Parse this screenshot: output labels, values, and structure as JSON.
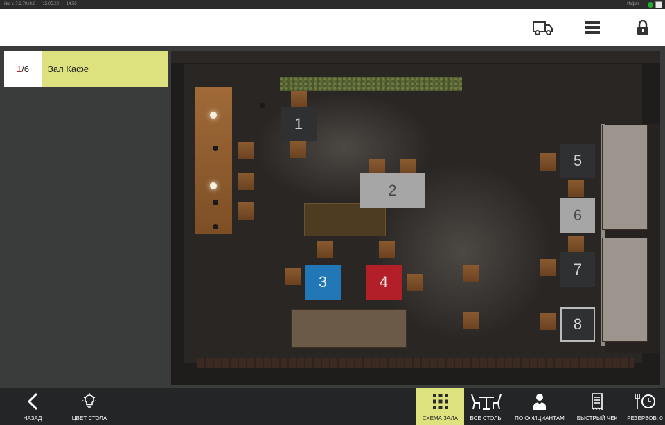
{
  "status_bar": {
    "app_version": "iiko v. 7.2.7014.0",
    "date": "15.05.20",
    "time": "14:56",
    "user": "Изфат",
    "status_color": "#22aa33"
  },
  "top_bar": {
    "icons": [
      "delivery-truck-icon",
      "menu-icon",
      "lock-icon"
    ]
  },
  "sidebar": {
    "hall": {
      "index_current": "1",
      "index_total": "/6",
      "name": "Зал Кафе",
      "accent": "#dde27e"
    }
  },
  "floor": {
    "tables": [
      {
        "number": "1",
        "style": "dark"
      },
      {
        "number": "2",
        "style": "grey"
      },
      {
        "number": "3",
        "style": "blue"
      },
      {
        "number": "4",
        "style": "red"
      },
      {
        "number": "5",
        "style": "dark"
      },
      {
        "number": "6",
        "style": "grey"
      },
      {
        "number": "7",
        "style": "dark"
      },
      {
        "number": "8",
        "style": "outlined"
      }
    ]
  },
  "bottom_bar": {
    "back": "НАЗАД",
    "table_color": "ЦВЕТ СТОЛА",
    "hall_scheme": "СХЕМА ЗАЛА",
    "all_tables": "ВСЕ СТОЛЫ",
    "by_waiters": "ПО ОФИЦИАНТАМ",
    "quick_check": "БЫСТРЫЙ ЧЕК",
    "reserves": "РЕЗЕРВОВ: 0",
    "active_color": "#dde27e"
  }
}
